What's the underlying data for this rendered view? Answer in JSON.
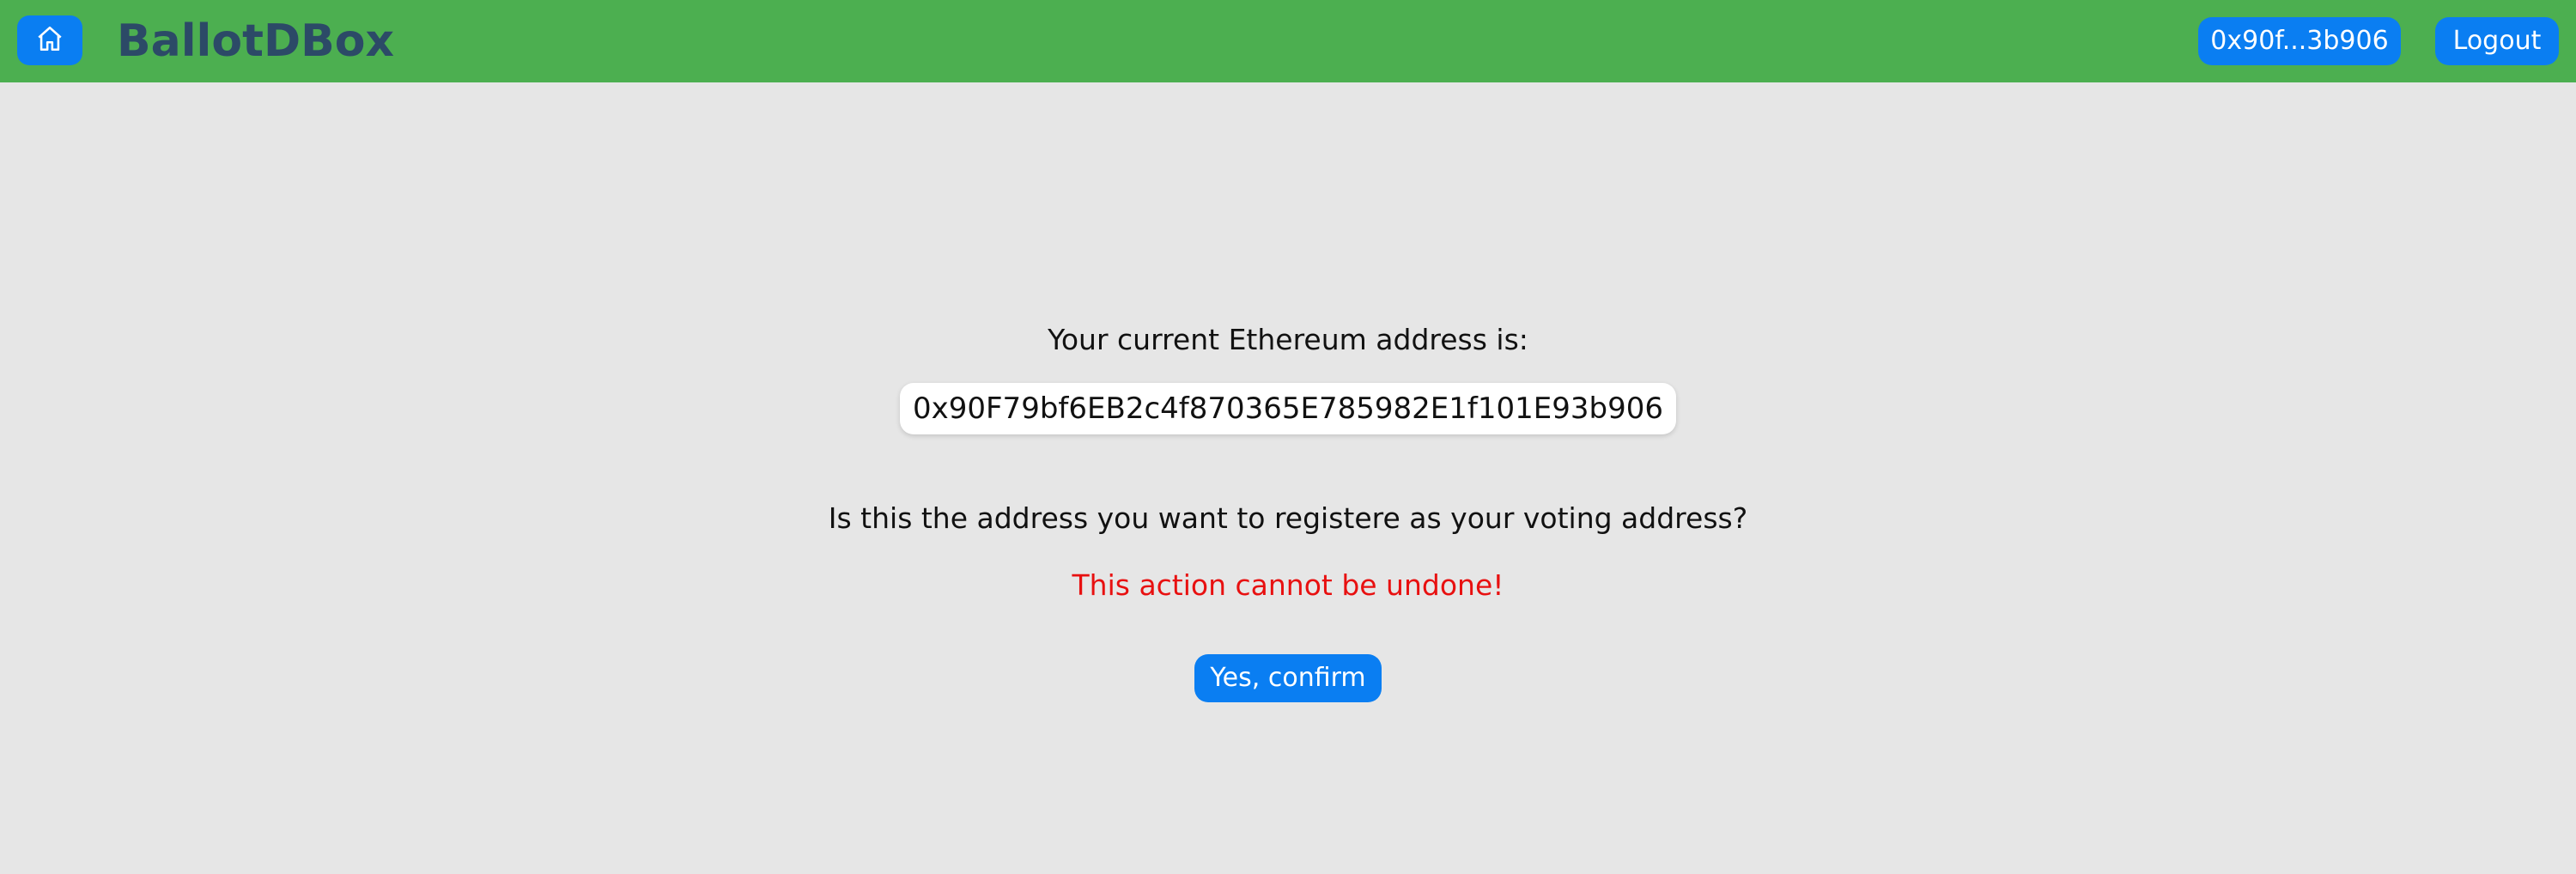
{
  "navbar": {
    "home_icon": "home-icon",
    "brand": "BallotDBox",
    "address_short": "0x90f...3b906",
    "logout_label": "Logout",
    "color": "#4caf50",
    "button_color": "#0a7ef2"
  },
  "main": {
    "current_address_label": "Your current Ethereum address is:",
    "address_full": "0x90F79bf6EB2c4f870365E785982E1f101E93b906",
    "question": "Is this the address you want to registere as your voting address?",
    "warning": "This action cannot be undone!",
    "confirm_label": "Yes, confirm",
    "warning_color": "#e81010"
  }
}
